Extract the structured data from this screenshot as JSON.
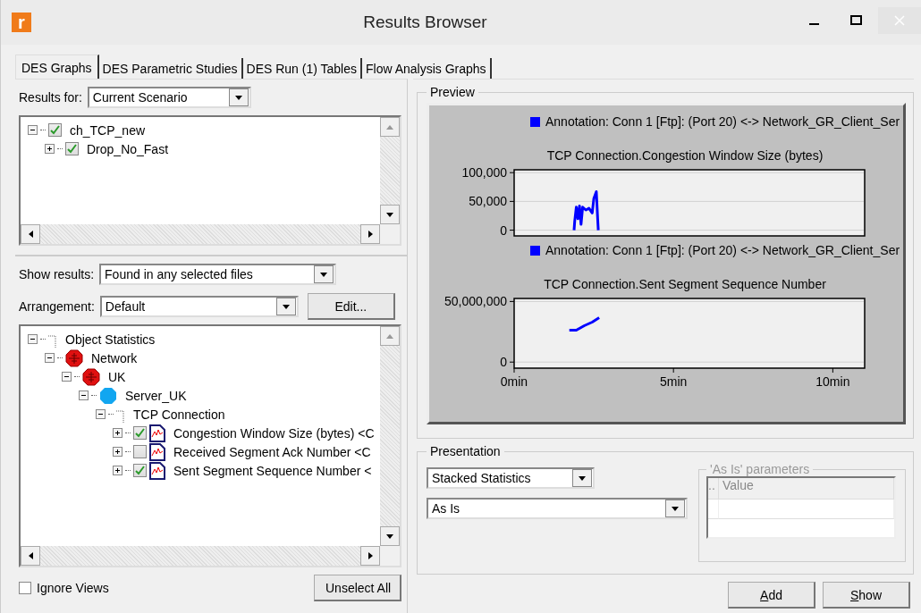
{
  "window": {
    "app_icon": "r",
    "title": "Results Browser"
  },
  "tabs": [
    {
      "label": "DES Graphs",
      "selected": true
    },
    {
      "label": "DES Parametric Studies",
      "selected": false
    },
    {
      "label": "DES Run (1) Tables",
      "selected": false
    },
    {
      "label": "Flow Analysis Graphs",
      "selected": false
    }
  ],
  "results_for": {
    "label": "Results for:",
    "value": "Current Scenario"
  },
  "scenario_tree": [
    {
      "label": "ch_TCP_new",
      "checked": true,
      "expanded": true,
      "children": [
        {
          "label": "Drop_No_Fast",
          "checked": true,
          "expanded": false
        }
      ]
    }
  ],
  "show_results": {
    "label": "Show results:",
    "value": "Found in any selected files"
  },
  "arrangement": {
    "label": "Arrangement:",
    "value": "Default",
    "button": "Edit..."
  },
  "object_tree": [
    {
      "kind": "folder",
      "label": "Object Statistics",
      "expanded": true,
      "children": [
        {
          "kind": "network",
          "label": "Network",
          "expanded": true,
          "children": [
            {
              "kind": "network",
              "label": "UK",
              "expanded": true,
              "children": [
                {
                  "kind": "server",
                  "label": "Server_UK",
                  "expanded": true,
                  "children": [
                    {
                      "kind": "folder",
                      "label": "TCP Connection",
                      "expanded": true,
                      "children": [
                        {
                          "kind": "statistic",
                          "label": "Congestion Window Size (bytes) <C",
                          "checked": true,
                          "expanded": false
                        },
                        {
                          "kind": "statistic",
                          "label": "Received Segment Ack Number <C",
                          "checked": false,
                          "expanded": false
                        },
                        {
                          "kind": "statistic",
                          "label": "Sent Segment Sequence Number <",
                          "checked": true,
                          "expanded": false
                        }
                      ]
                    }
                  ]
                }
              ]
            }
          ]
        }
      ]
    }
  ],
  "ignore_views": {
    "label": "Ignore Views",
    "checked": false
  },
  "unselect_all": "Unselect All",
  "preview": {
    "title": "Preview",
    "charts": [
      {
        "chart_data": {
          "type": "line",
          "grid": true,
          "title": "TCP Connection.Congestion Window Size (bytes)",
          "x": [
            1.88,
            1.9,
            1.95,
            2.0,
            2.05,
            2.1,
            2.15,
            2.25,
            2.35,
            2.45,
            2.5,
            2.58,
            2.62,
            2.64
          ],
          "xlim": [
            0,
            11
          ],
          "ylim": [
            -10000,
            105000
          ],
          "yticks": [
            {
              "value": 0,
              "label": "0"
            },
            {
              "value": 50000,
              "label": "50,000"
            },
            {
              "value": 100000,
              "label": "100,000"
            }
          ],
          "series": [
            {
              "name": "Annotation: Conn 1 [Ftp]: (Port 20) <-> Network_GR_Client_Ser",
              "color": "#0000ff",
              "values": [
                0,
                15000,
                40000,
                20000,
                42000,
                10000,
                40000,
                35000,
                38000,
                30000,
                55000,
                67000,
                20000,
                0
              ]
            }
          ]
        }
      },
      {
        "chart_data": {
          "type": "line",
          "grid": true,
          "title": "TCP Connection.Sent Segment Sequence Number",
          "x": [
            1.73,
            1.95,
            2.2,
            2.45,
            2.67
          ],
          "xlim": [
            0,
            11
          ],
          "ylim": [
            -5000000,
            52500000
          ],
          "xticks": [
            {
              "value": 0,
              "label": "0min"
            },
            {
              "value": 5,
              "label": "5min"
            },
            {
              "value": 10,
              "label": "10min"
            }
          ],
          "yticks": [
            {
              "value": 0,
              "label": "0"
            },
            {
              "value": 50000000,
              "label": "50,000,000"
            }
          ],
          "series": [
            {
              "name": "Annotation: Conn 1 [Ftp]: (Port 20) <-> Network_GR_Client_Ser",
              "color": "#0000ff",
              "values": [
                26300000,
                26300000,
                30000000,
                33000000,
                36600000
              ]
            }
          ]
        }
      }
    ]
  },
  "presentation": {
    "title": "Presentation",
    "mode": "Stacked Statistics",
    "filter": "As Is",
    "parameters": {
      "title": "'As Is' parameters",
      "disabled": true,
      "columns": [
        "..",
        "Value"
      ]
    }
  },
  "buttons": [
    "Add",
    "Show"
  ]
}
